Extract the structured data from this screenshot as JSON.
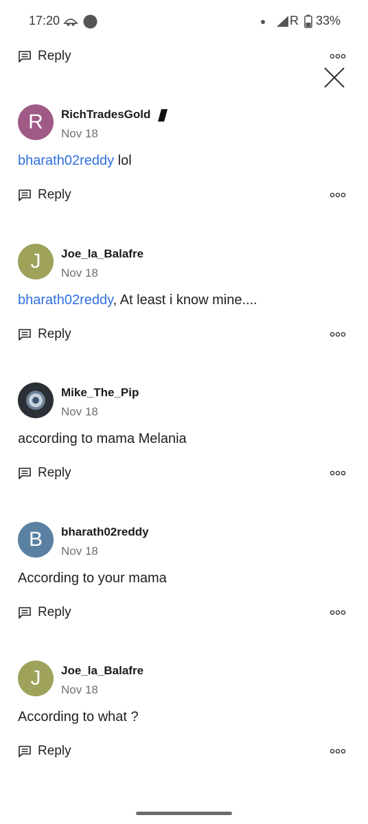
{
  "status": {
    "time": "17:20",
    "network_letter": "R",
    "battery": "33%"
  },
  "top": {
    "reply_label": "Reply"
  },
  "comments": [
    {
      "initial": "R",
      "avatar_color": "#a05a86",
      "username": "RichTradesGold",
      "date": "Nov 18",
      "mention": "bharath02reddy",
      "text": " lol",
      "reply_label": "Reply"
    },
    {
      "initial": "J",
      "avatar_color": "#9ea25b",
      "username": "Joe_la_Balafre",
      "date": "Nov 18",
      "mention": "bharath02reddy",
      "text": ", At least i know mine....",
      "reply_label": "Reply"
    },
    {
      "initial": "",
      "avatar_color": "#2b3036",
      "username": "Mike_The_Pip",
      "date": "Nov 18",
      "mention": "",
      "text": "according to mama Melania",
      "reply_label": "Reply"
    },
    {
      "initial": "B",
      "avatar_color": "#5a81a2",
      "username": "bharath02reddy",
      "date": "Nov 18",
      "mention": "",
      "text": "According to your mama",
      "reply_label": "Reply"
    },
    {
      "initial": "J",
      "avatar_color": "#9ea25b",
      "username": "Joe_la_Balafre",
      "date": "Nov 18",
      "mention": "",
      "text": "According to what ?",
      "reply_label": "Reply"
    }
  ],
  "icons": {
    "reply": "comment-icon",
    "more": "more-dots-icon",
    "close": "close-icon",
    "badge": "rank-badge-icon"
  }
}
